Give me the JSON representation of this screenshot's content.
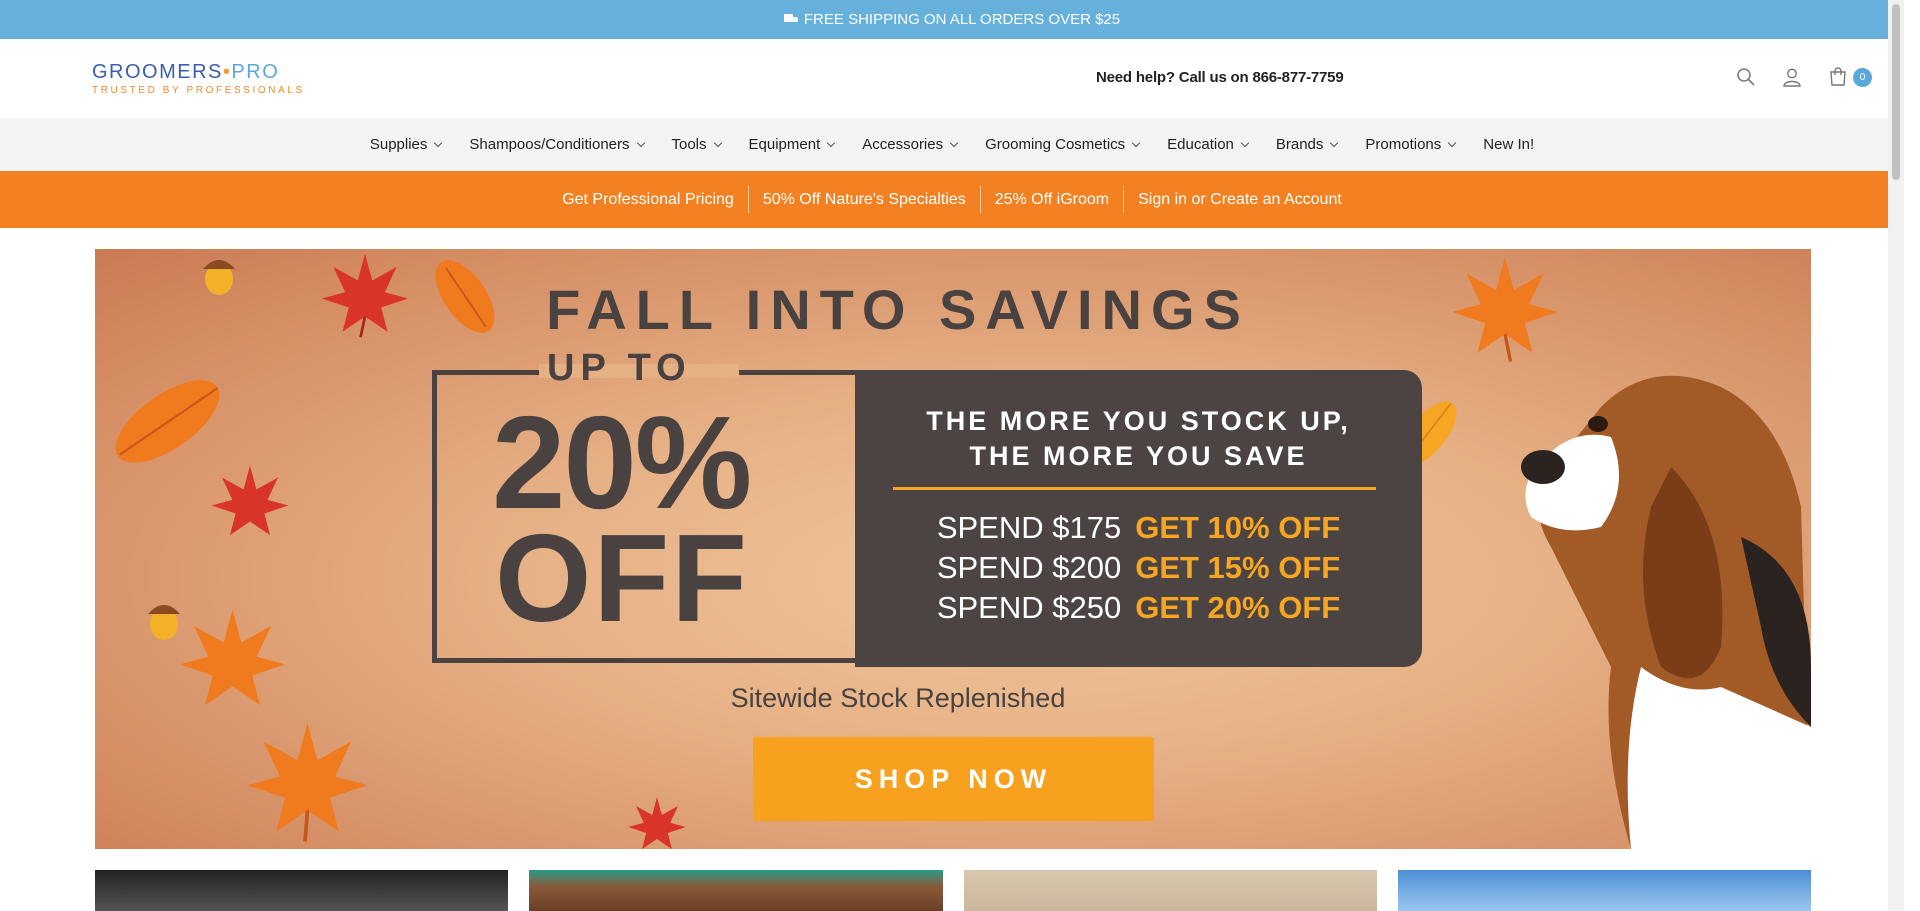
{
  "announcement": {
    "text": "FREE SHIPPING ON ALL ORDERS OVER $25",
    "icon": "truck-icon"
  },
  "header": {
    "logo_main": "GROOMERS",
    "logo_dot": "•",
    "logo_pro": "PRO",
    "logo_tagline": "TRUSTED BY PROFESSIONALS",
    "help_text": "Need help? Call us on 866-877-7759",
    "cart_count": "0",
    "icons": [
      "search-icon",
      "user-icon",
      "cart-icon"
    ]
  },
  "nav": {
    "items": [
      {
        "label": "Supplies",
        "has_dropdown": true
      },
      {
        "label": "Shampoos/Conditioners",
        "has_dropdown": true
      },
      {
        "label": "Tools",
        "has_dropdown": true
      },
      {
        "label": "Equipment",
        "has_dropdown": true
      },
      {
        "label": "Accessories",
        "has_dropdown": true
      },
      {
        "label": "Grooming Cosmetics",
        "has_dropdown": true
      },
      {
        "label": "Education",
        "has_dropdown": true
      },
      {
        "label": "Brands",
        "has_dropdown": true
      },
      {
        "label": "Promotions",
        "has_dropdown": true
      },
      {
        "label": "New In!",
        "has_dropdown": false
      }
    ]
  },
  "promo_bar": {
    "links": [
      "Get Professional Pricing",
      "50% Off Nature's Specialties",
      "25% Off iGroom",
      "Sign in or Create an Account"
    ]
  },
  "hero": {
    "headline": "FALL INTO SAVINGS",
    "up_to": "UP TO",
    "percent": "20%",
    "off": "OFF",
    "tagline_line1": "THE MORE YOU STOCK UP,",
    "tagline_line2": "THE MORE YOU SAVE",
    "tiers": [
      {
        "spend": "SPEND $175",
        "get": "GET 10% OFF"
      },
      {
        "spend": "SPEND $200",
        "get": "GET 15% OFF"
      },
      {
        "spend": "SPEND $250",
        "get": "GET 20% OFF"
      }
    ],
    "subtitle": "Sitewide Stock Replenished",
    "cta": "SHOP NOW"
  },
  "colors": {
    "announcement_bg": "#66b0dc",
    "promo_bg": "#f48121",
    "accent_orange": "#f8a11f",
    "dark_panel": "#4c4442",
    "brand_blue": "#3b5ea8"
  }
}
